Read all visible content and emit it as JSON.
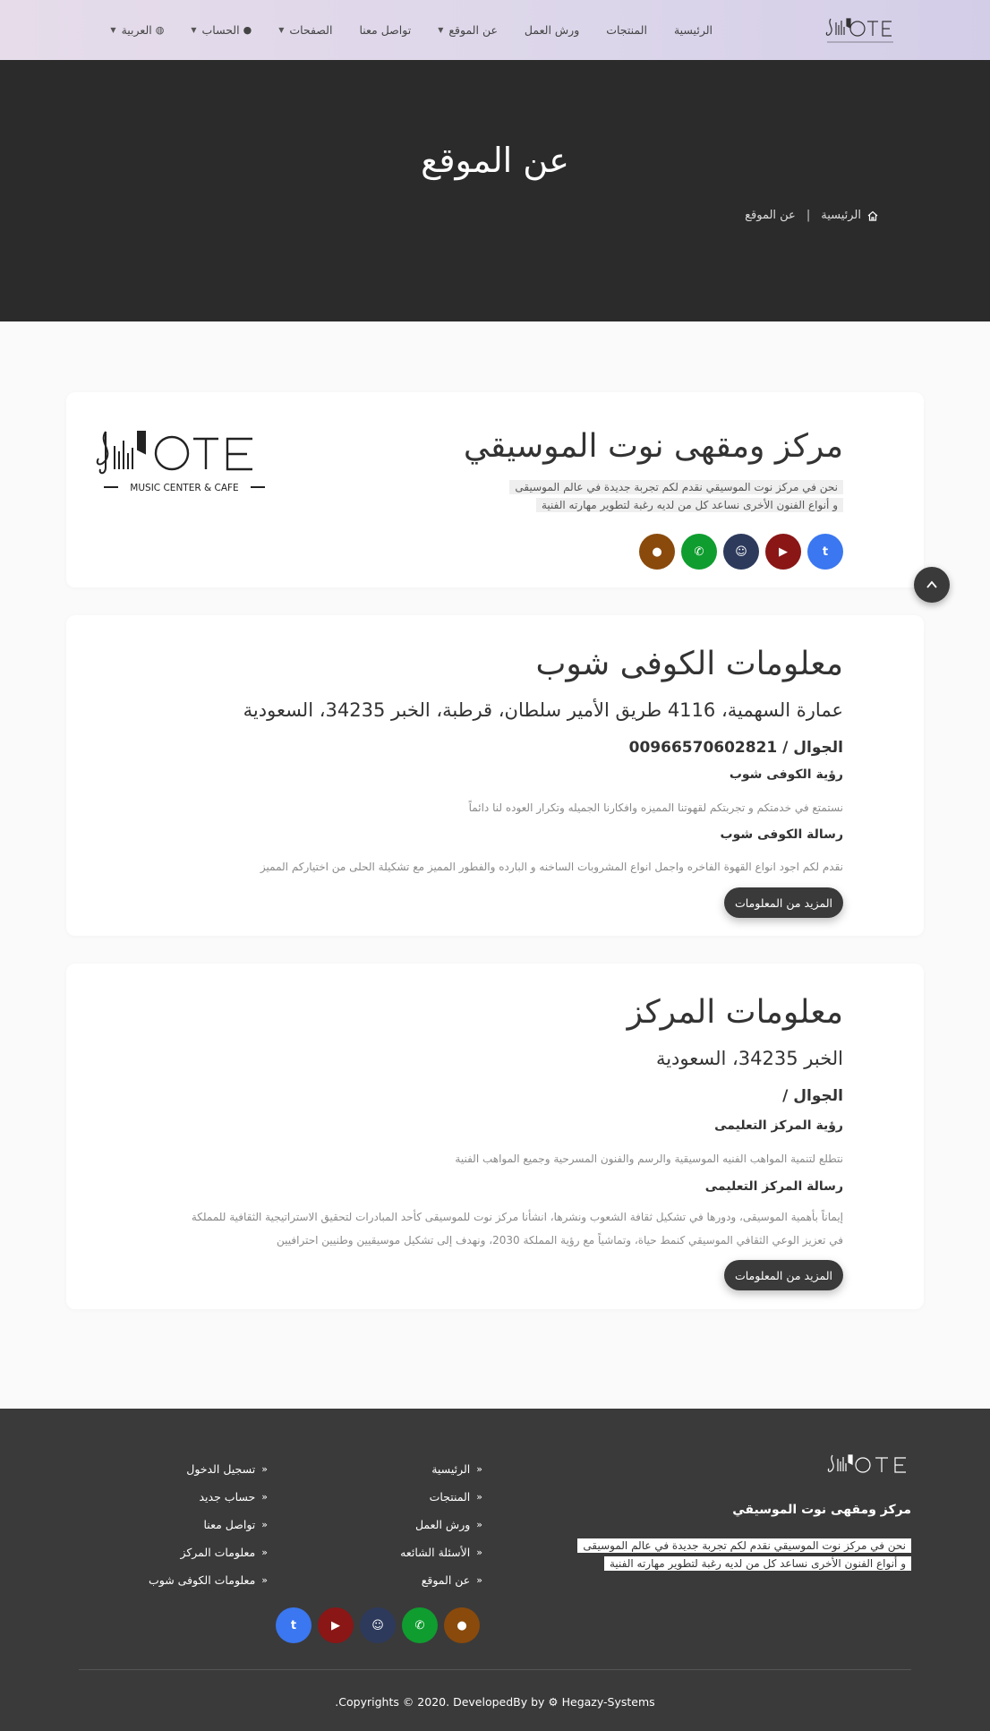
{
  "nav": {
    "items": [
      {
        "label": "الرئيسية",
        "caret": false
      },
      {
        "label": "المنتجات",
        "caret": false
      },
      {
        "label": "ورش العمل",
        "caret": false
      },
      {
        "label": "عن الموقع",
        "caret": true
      },
      {
        "label": "تواصل معنا",
        "caret": false
      },
      {
        "label": "الصفحات",
        "caret": true
      },
      {
        "label": "الحساب",
        "caret": true,
        "icon": "user-icon"
      },
      {
        "label": "العربية",
        "caret": true,
        "icon": "globe-icon"
      }
    ]
  },
  "hero": {
    "title": "عن الموقع",
    "breadcrumb_home": "الرئيسية",
    "breadcrumb_current": "عن الموقع"
  },
  "brand": {
    "logo_text": "OTE",
    "logo_subtitle": "MUSIC CENTER & CAFE"
  },
  "intro": {
    "title": "مركز ومقهى نوت الموسيقي",
    "desc_line1": "نحن في مركز نوت الموسيقي نقدم لكم تجربة جديدة في عالم الموسيقى",
    "desc_line2": "و أنواع الفنون الأخرى  نساعد كل من لديه رغبة لتطوير مهارته الفنية"
  },
  "coffee": {
    "title": "معلومات الكوفى شوب",
    "address": "عمارة السهمية، 4116 طريق الأمير سلطان، قرطبة، الخبر 34235، السعودية",
    "phone": "الجوال / 00966570602821",
    "vision_title": "رؤية الكوفى شوب",
    "vision_text": "نستمتع في خدمتكم و تجربتكم لقهوتنا المميزه وافكارنا الجميله وتكرار العوده لنا دائماً",
    "mission_title": "رسالة الكوفى شوب",
    "mission_text": "نقدم لكم اجود انواع القهوة الفاخره واجمل انواع المشروبات الساخنه و البارده والفطور المميز مع تشكيلة الحلى من اختياركم المميز",
    "more_label": "المزيد من المعلومات"
  },
  "center": {
    "title": "معلومات المركز",
    "address": "الخبر 34235، السعودية",
    "phone": "الجوال /",
    "vision_title": "رؤية المركز التعليمى",
    "vision_text": "نتطلع لتنمية المواهب الفنيه الموسيقية والرسم والفنون المسرحية وجميع المواهب الفنية",
    "mission_title": "رسالة المركز التعليمى",
    "mission_line1": "إيماناً بأهمية الموسيقى، ودورها في تشكيل ثقافة الشعوب ونشرها، انشأنا مركز نوت للموسيقى كأحد المبادرات لتحقيق الاستراتيجية الثقافية للمملكة",
    "mission_line2": "في تعزيز الوعي الثقافي الموسيقي كنمط حياة، وتماشياً مع رؤية المملكة 2030، ونهدف إلى تشكيل موسيقيين وطنيين احترافيين",
    "more_label": "المزيد من المعلومات"
  },
  "footer": {
    "title": "مركز ومقهى نوت الموسيقي",
    "desc_line1": "نحن في مركز نوت الموسيقي نقدم لكم تجربة جديدة في عالم الموسيقى",
    "desc_line2": "و أنواع الفنون الأخرى  نساعد كل من لديه رغبة لتطوير مهارته الفنية",
    "col1": [
      "الرئيسية",
      "المنتجات",
      "ورش العمل",
      "الأسئلة الشائعه",
      "عن الموقع"
    ],
    "col2": [
      "تسجيل الدخول",
      "حساب جديد",
      "تواصل معنا",
      "معلومات المركز",
      "معلومات الكوفى شوب"
    ],
    "copyright_prefix": ".Copyrights © 2020. DevelopedBy by",
    "copyright_brand": "Hegazy-Systems"
  },
  "social": [
    {
      "icon": "twitter-icon",
      "glyph": "t",
      "color": "#3a77f0"
    },
    {
      "icon": "youtube-icon",
      "glyph": "▶",
      "color": "#8a1616"
    },
    {
      "icon": "snapchat-icon",
      "glyph": "☺",
      "color": "#2d3a5c"
    },
    {
      "icon": "whatsapp-icon",
      "glyph": "✆",
      "color": "#0f9d2f"
    },
    {
      "icon": "chat-icon",
      "glyph": "●",
      "color": "#8a4a0c"
    }
  ]
}
